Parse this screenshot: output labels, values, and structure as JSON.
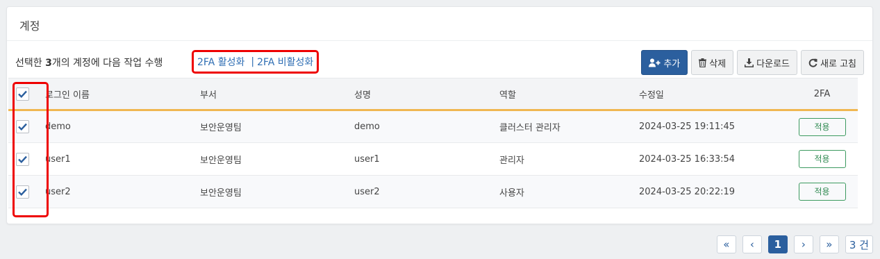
{
  "panel": {
    "title": "계정"
  },
  "action": {
    "prefix": "선택한 ",
    "count": "3",
    "suffix": "개의 계정에 다음 작업 수행",
    "enable_2fa": "2FA 활성화",
    "separator": "|",
    "disable_2fa": "2FA 비활성화"
  },
  "toolbar": {
    "add_label": "추가",
    "delete_label": "삭제",
    "download_label": "다운로드",
    "refresh_label": "새로 고침"
  },
  "table": {
    "headers": [
      "로그인 이름",
      "부서",
      "성명",
      "역할",
      "수정일",
      "2FA"
    ],
    "rows": [
      {
        "login": "demo",
        "dept": "보안운영팀",
        "name": "demo",
        "role": "클러스터 관리자",
        "modified": "2024-03-25 19:11:45",
        "twofa": "적용",
        "checked": true
      },
      {
        "login": "user1",
        "dept": "보안운영팀",
        "name": "user1",
        "role": "관리자",
        "modified": "2024-03-25 16:33:54",
        "twofa": "적용",
        "checked": true
      },
      {
        "login": "user2",
        "dept": "보안운영팀",
        "name": "user2",
        "role": "사용자",
        "modified": "2024-03-25 20:22:19",
        "twofa": "적용",
        "checked": true
      }
    ]
  },
  "pagination": {
    "first": "«",
    "prev": "‹",
    "current_page": "1",
    "next": "›",
    "last": "»",
    "total": "3 건"
  },
  "colors": {
    "primary": "#2b5f9e",
    "link": "#2d6db3",
    "highlight": "#ee0000",
    "header_underline": "#f0b751",
    "badge_green": "#2f8a51"
  }
}
